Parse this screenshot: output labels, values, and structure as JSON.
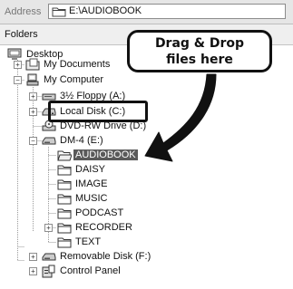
{
  "address_bar": {
    "label": "Address",
    "path": "E:\\AUDIOBOOK"
  },
  "folders_pane": {
    "title": "Folders"
  },
  "tree": [
    {
      "label": "Desktop",
      "icon": "desktop-icon",
      "expander": null
    },
    {
      "label": "My Documents",
      "icon": "my-documents-icon",
      "expander": "+"
    },
    {
      "label": "My Computer",
      "icon": "my-computer-icon",
      "expander": "-"
    },
    {
      "label": "3½ Floppy (A:)",
      "icon": "floppy-drive-icon",
      "expander": "+"
    },
    {
      "label": "Local Disk (C:)",
      "icon": "hard-disk-icon",
      "expander": "+"
    },
    {
      "label": "DVD-RW Drive (D:)",
      "icon": "dvd-drive-icon",
      "expander": null
    },
    {
      "label": "DM-4 (E:)",
      "icon": "removable-drive-icon",
      "expander": "-"
    },
    {
      "label": "AUDIOBOOK",
      "icon": "folder-open-icon",
      "expander": null,
      "selected": true
    },
    {
      "label": "DAISY",
      "icon": "folder-icon",
      "expander": null
    },
    {
      "label": "IMAGE",
      "icon": "folder-icon",
      "expander": null
    },
    {
      "label": "MUSIC",
      "icon": "folder-icon",
      "expander": null
    },
    {
      "label": "PODCAST",
      "icon": "folder-icon",
      "expander": null
    },
    {
      "label": "RECORDER",
      "icon": "folder-icon",
      "expander": "+"
    },
    {
      "label": "TEXT",
      "icon": "folder-icon",
      "expander": null
    },
    {
      "label": "Removable Disk (F:)",
      "icon": "removable-drive-icon",
      "expander": "+"
    },
    {
      "label": "Control Panel",
      "icon": "control-panel-icon",
      "expander": "+"
    }
  ],
  "callout": {
    "line1": "Drag & Drop",
    "line2": "files here"
  },
  "colors": {
    "selection": "#5a5a5a",
    "annotation": "#111111"
  }
}
